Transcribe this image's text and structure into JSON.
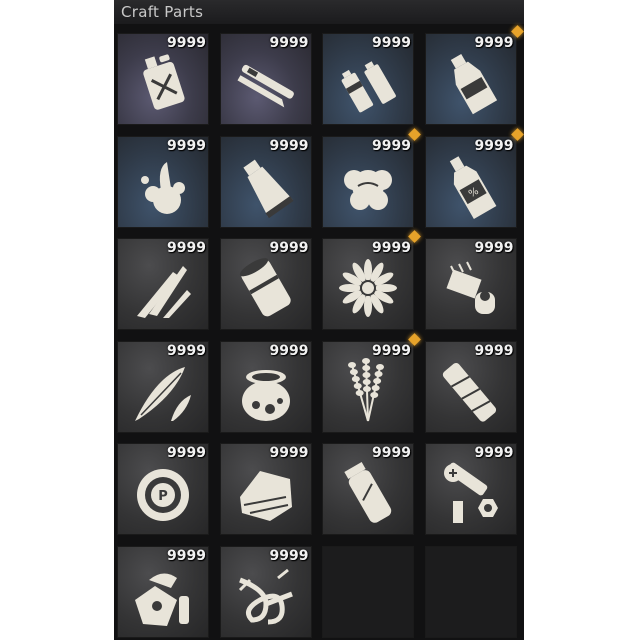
{
  "title": "Craft Parts",
  "colors": {
    "badge": "#e7a32a",
    "icon": "#e8e4d9"
  },
  "items": [
    {
      "icon": "jerrycan-icon",
      "count": "9999",
      "tint": "purple",
      "badge": false
    },
    {
      "icon": "folding-knife-icon",
      "count": "9999",
      "tint": "purple",
      "badge": false
    },
    {
      "icon": "batteries-icon",
      "count": "9999",
      "tint": "blue",
      "badge": false
    },
    {
      "icon": "bottle-icon",
      "count": "9999",
      "tint": "blue",
      "badge": true
    },
    {
      "icon": "glue-splash-icon",
      "count": "9999",
      "tint": "blue",
      "badge": false
    },
    {
      "icon": "tube-icon",
      "count": "9999",
      "tint": "blue",
      "badge": false
    },
    {
      "icon": "cotton-flower-icon",
      "count": "9999",
      "tint": "blue",
      "badge": true
    },
    {
      "icon": "alcohol-bottle-icon",
      "count": "9999",
      "tint": "blue",
      "badge": true
    },
    {
      "icon": "knife-blades-icon",
      "count": "9999",
      "tint": "",
      "badge": false
    },
    {
      "icon": "can-icon",
      "count": "9999",
      "tint": "",
      "badge": false
    },
    {
      "icon": "daisy-flower-icon",
      "count": "9999",
      "tint": "",
      "badge": true
    },
    {
      "icon": "electronic-parts-icon",
      "count": "9999",
      "tint": "",
      "badge": false
    },
    {
      "icon": "feathers-icon",
      "count": "9999",
      "tint": "",
      "badge": false
    },
    {
      "icon": "honey-pot-icon",
      "count": "9999",
      "tint": "",
      "badge": false
    },
    {
      "icon": "lavender-icon",
      "count": "9999",
      "tint": "",
      "badge": true
    },
    {
      "icon": "bandage-roll-icon",
      "count": "9999",
      "tint": "",
      "badge": false
    },
    {
      "icon": "powder-tin-icon",
      "count": "9999",
      "tint": "",
      "badge": false
    },
    {
      "icon": "cloth-rags-icon",
      "count": "9999",
      "tint": "",
      "badge": false
    },
    {
      "icon": "vial-icon",
      "count": "9999",
      "tint": "",
      "badge": false
    },
    {
      "icon": "screws-bolts-icon",
      "count": "9999",
      "tint": "",
      "badge": false
    },
    {
      "icon": "whetstone-icon",
      "count": "9999",
      "tint": "",
      "badge": false
    },
    {
      "icon": "rope-knot-icon",
      "count": "9999",
      "tint": "",
      "badge": false
    }
  ]
}
